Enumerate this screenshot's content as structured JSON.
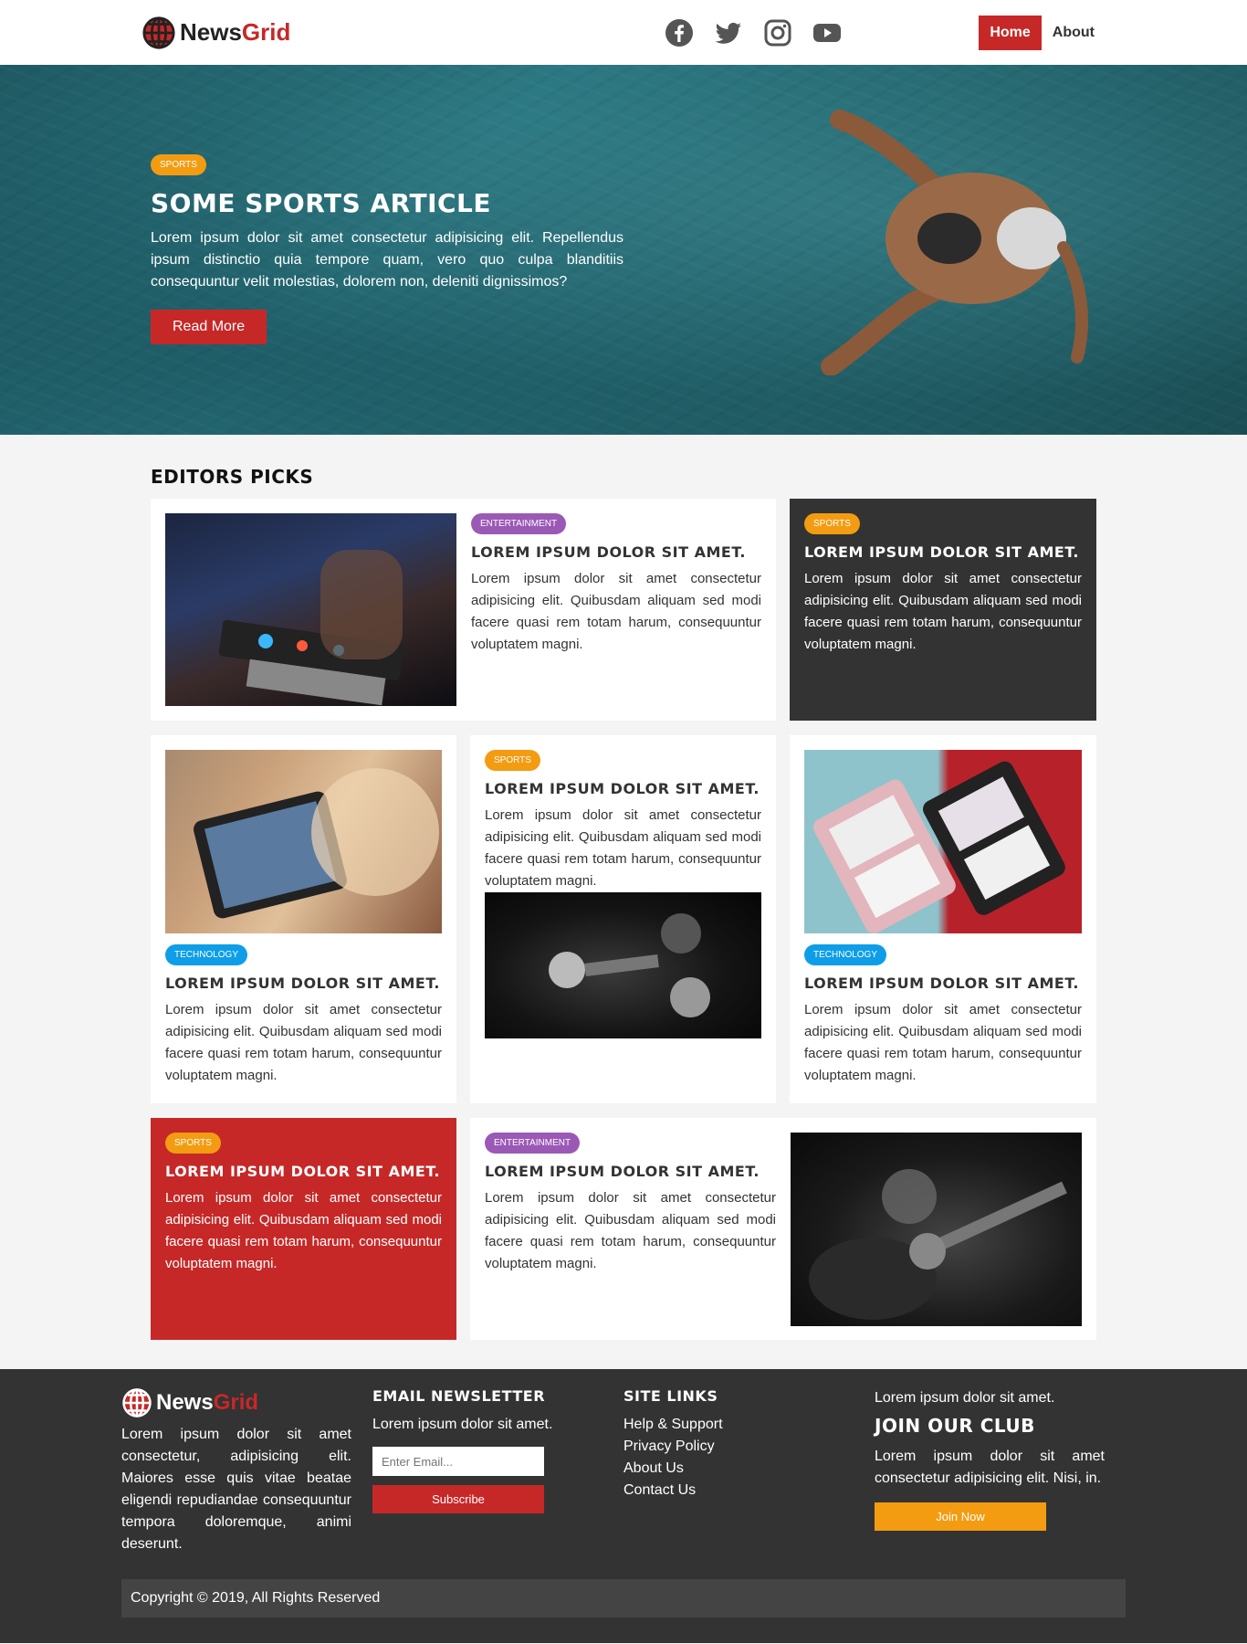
{
  "nav": {
    "logo_part1": "News",
    "logo_part2": "Grid",
    "social": [
      "facebook-icon",
      "twitter-icon",
      "instagram-icon",
      "youtube-icon"
    ],
    "links": [
      {
        "label": "Home",
        "active": true
      },
      {
        "label": "About",
        "active": false
      }
    ]
  },
  "hero": {
    "tag": "SPORTS",
    "title": "SOME SPORTS ARTICLE",
    "text": "Lorem ipsum dolor sit amet consectetur adipisicing elit. Repellendus ipsum distinctio quia tempore quam, vero quo culpa blanditiis consequuntur velit molestias, dolorem non, deleniti dignissimos?",
    "button": "Read More"
  },
  "picks": {
    "heading": "EDITORS PICKS",
    "cards": [
      {
        "tag": "ENTERTAINMENT",
        "title": "LOREM IPSUM DOLOR SIT AMET.",
        "text": "Lorem ipsum dolor sit amet consectetur adipisicing elit. Quibusdam aliquam sed modi facere quasi rem totam harum, consequuntur voluptatem magni."
      },
      {
        "tag": "SPORTS",
        "title": "LOREM IPSUM DOLOR SIT AMET.",
        "text": "Lorem ipsum dolor sit amet consectetur adipisicing elit. Quibusdam aliquam sed modi facere quasi rem totam harum, consequuntur voluptatem magni."
      },
      {
        "tag": "TECHNOLOGY",
        "title": "LOREM IPSUM DOLOR SIT AMET.",
        "text": "Lorem ipsum dolor sit amet consectetur adipisicing elit. Quibusdam aliquam sed modi facere quasi rem totam harum, consequuntur voluptatem magni."
      },
      {
        "tag": "SPORTS",
        "title": "LOREM IPSUM DOLOR SIT AMET.",
        "text": "Lorem ipsum dolor sit amet consectetur adipisicing elit. Quibusdam aliquam sed modi facere quasi rem totam harum, consequuntur voluptatem magni."
      },
      {
        "tag": "TECHNOLOGY",
        "title": "LOREM IPSUM DOLOR SIT AMET.",
        "text": "Lorem ipsum dolor sit amet consectetur adipisicing elit. Quibusdam aliquam sed modi facere quasi rem totam harum, consequuntur voluptatem magni."
      },
      {
        "tag": "SPORTS",
        "title": "LOREM IPSUM DOLOR SIT AMET.",
        "text": "Lorem ipsum dolor sit amet consectetur adipisicing elit. Quibusdam aliquam sed modi facere quasi rem totam harum, consequuntur voluptatem magni."
      },
      {
        "tag": "ENTERTAINMENT",
        "title": "LOREM IPSUM DOLOR SIT AMET.",
        "text": "Lorem ipsum dolor sit amet consectetur adipisicing elit. Quibusdam aliquam sed modi facere quasi rem totam harum, consequuntur voluptatem magni."
      }
    ]
  },
  "footer": {
    "about_text": "Lorem ipsum dolor sit amet consectetur, adipisicing elit. Maiores esse quis vitae beatae eligendi repudiandae consequuntur tempora doloremque, animi deserunt.",
    "newsletter_heading": "EMAIL NEWSLETTER",
    "newsletter_text": "Lorem ipsum dolor sit amet.",
    "email_placeholder": "Enter Email...",
    "subscribe": "Subscribe",
    "links_heading": "SITE LINKS",
    "links": [
      "Help & Support",
      "Privacy Policy",
      "About Us",
      "Contact Us"
    ],
    "club_intro": "Lorem ipsum dolor sit amet.",
    "club_heading": "JOIN OUR CLUB",
    "club_text": "Lorem ipsum dolor sit amet consectetur adipisicing elit. Nisi, in.",
    "join": "Join Now",
    "copyright": "Copyright © 2019, All Rights Reserved"
  },
  "colors": {
    "primary": "#c62828",
    "dark": "#333333",
    "sports": "#f39c12",
    "entertainment": "#9b59b6",
    "technology": "#0e9ee8"
  }
}
